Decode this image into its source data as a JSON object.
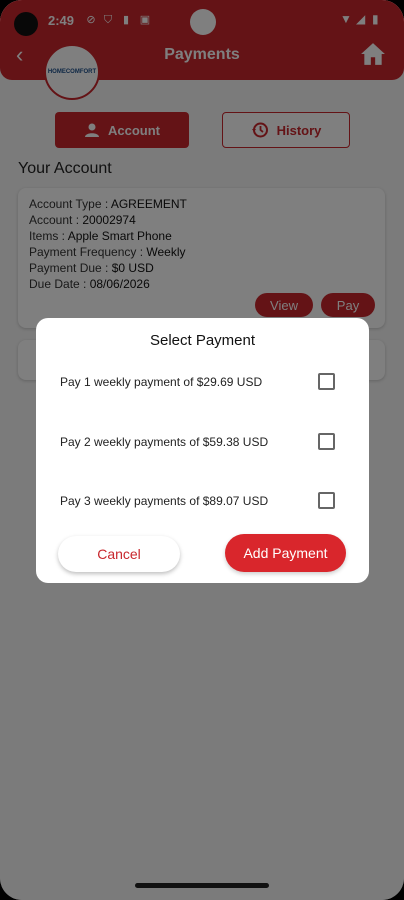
{
  "status_bar": {
    "time": "2:49"
  },
  "header": {
    "title": "Payments",
    "logo_text": "HOMECOMFORT"
  },
  "tabs": [
    {
      "label": "Account",
      "icon": "person-icon",
      "active": true
    },
    {
      "label": "History",
      "icon": "history-icon",
      "active": false
    }
  ],
  "section_title": "Your Account",
  "account": {
    "type_label": "Account Type : ",
    "type_value": "AGREEMENT",
    "number_label": "Account : ",
    "number_value": "20002974",
    "items_label": "Items : ",
    "items_value": "Apple Smart Phone",
    "frequency_label": "Payment Frequency : ",
    "frequency_value": "Weekly",
    "due_label": "Payment Due : ",
    "due_value": "$0 USD",
    "date_label": "Due Date : ",
    "date_value": "08/06/2026",
    "view_label": "View",
    "pay_label": "Pay"
  },
  "dialog": {
    "title": "Select Payment",
    "options": [
      {
        "label": "Pay 1 weekly payment of $29.69 USD",
        "checked": false
      },
      {
        "label": "Pay 2 weekly payments of $59.38 USD",
        "checked": false
      },
      {
        "label": "Pay 3 weekly payments of $89.07 USD",
        "checked": false
      }
    ],
    "cancel_label": "Cancel",
    "add_label": "Add Payment"
  },
  "colors": {
    "brand": "#c8272d",
    "accent_button": "#d9262c"
  }
}
